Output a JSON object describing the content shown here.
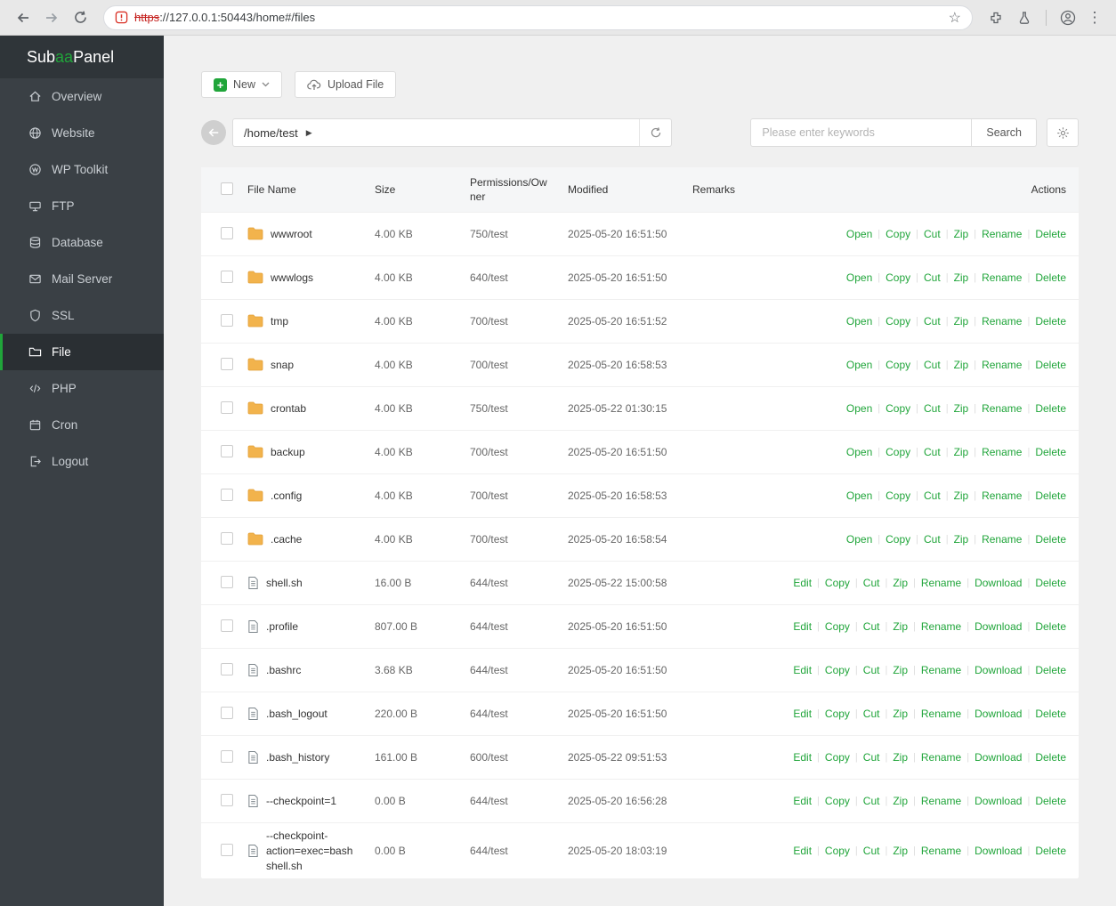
{
  "browser": {
    "url_scheme": "https",
    "url_rest": "://127.0.0.1:50443/home#/files"
  },
  "sidebar": {
    "logo": {
      "prefix": "Sub ",
      "accent": "aa",
      "suffix": "Panel"
    },
    "items": [
      {
        "label": "Overview",
        "icon": "home-icon",
        "active": false
      },
      {
        "label": "Website",
        "icon": "globe-icon",
        "active": false
      },
      {
        "label": "WP Toolkit",
        "icon": "wordpress-icon",
        "active": false
      },
      {
        "label": "FTP",
        "icon": "server-icon",
        "active": false
      },
      {
        "label": "Database",
        "icon": "database-icon",
        "active": false
      },
      {
        "label": "Mail Server",
        "icon": "mail-icon",
        "active": false
      },
      {
        "label": "SSL",
        "icon": "shield-icon",
        "active": false
      },
      {
        "label": "File",
        "icon": "folder-icon",
        "active": true
      },
      {
        "label": "PHP",
        "icon": "code-icon",
        "active": false
      },
      {
        "label": "Cron",
        "icon": "calendar-icon",
        "active": false
      },
      {
        "label": "Logout",
        "icon": "logout-icon",
        "active": false
      }
    ]
  },
  "toolbar": {
    "new_label": "New",
    "upload_label": "Upload File",
    "path": "/home/test",
    "search_placeholder": "Please enter keywords",
    "search_label": "Search"
  },
  "table": {
    "headers": [
      "File Name",
      "Size",
      "Permissions/Owner",
      "Modified",
      "Remarks",
      "Actions"
    ],
    "rows": [
      {
        "name": "wwwroot",
        "type": "folder",
        "size": "4.00 KB",
        "permissions": "750/test",
        "modified": "2025-05-20 16:51:50",
        "remarks": "",
        "actions": [
          "Open",
          "Copy",
          "Cut",
          "Zip",
          "Rename",
          "Delete"
        ]
      },
      {
        "name": "wwwlogs",
        "type": "folder",
        "size": "4.00 KB",
        "permissions": "640/test",
        "modified": "2025-05-20 16:51:50",
        "remarks": "",
        "actions": [
          "Open",
          "Copy",
          "Cut",
          "Zip",
          "Rename",
          "Delete"
        ]
      },
      {
        "name": "tmp",
        "type": "folder",
        "size": "4.00 KB",
        "permissions": "700/test",
        "modified": "2025-05-20 16:51:52",
        "remarks": "",
        "actions": [
          "Open",
          "Copy",
          "Cut",
          "Zip",
          "Rename",
          "Delete"
        ]
      },
      {
        "name": "snap",
        "type": "folder",
        "size": "4.00 KB",
        "permissions": "700/test",
        "modified": "2025-05-20 16:58:53",
        "remarks": "",
        "actions": [
          "Open",
          "Copy",
          "Cut",
          "Zip",
          "Rename",
          "Delete"
        ]
      },
      {
        "name": "crontab",
        "type": "folder",
        "size": "4.00 KB",
        "permissions": "750/test",
        "modified": "2025-05-22 01:30:15",
        "remarks": "",
        "actions": [
          "Open",
          "Copy",
          "Cut",
          "Zip",
          "Rename",
          "Delete"
        ]
      },
      {
        "name": "backup",
        "type": "folder",
        "size": "4.00 KB",
        "permissions": "700/test",
        "modified": "2025-05-20 16:51:50",
        "remarks": "",
        "actions": [
          "Open",
          "Copy",
          "Cut",
          "Zip",
          "Rename",
          "Delete"
        ]
      },
      {
        "name": ".config",
        "type": "folder",
        "size": "4.00 KB",
        "permissions": "700/test",
        "modified": "2025-05-20 16:58:53",
        "remarks": "",
        "actions": [
          "Open",
          "Copy",
          "Cut",
          "Zip",
          "Rename",
          "Delete"
        ]
      },
      {
        "name": ".cache",
        "type": "folder",
        "size": "4.00 KB",
        "permissions": "700/test",
        "modified": "2025-05-20 16:58:54",
        "remarks": "",
        "actions": [
          "Open",
          "Copy",
          "Cut",
          "Zip",
          "Rename",
          "Delete"
        ]
      },
      {
        "name": "shell.sh",
        "type": "file",
        "size": "16.00 B",
        "permissions": "644/test",
        "modified": "2025-05-22 15:00:58",
        "remarks": "",
        "actions": [
          "Edit",
          "Copy",
          "Cut",
          "Zip",
          "Rename",
          "Download",
          "Delete"
        ]
      },
      {
        "name": ".profile",
        "type": "file",
        "size": "807.00 B",
        "permissions": "644/test",
        "modified": "2025-05-20 16:51:50",
        "remarks": "",
        "actions": [
          "Edit",
          "Copy",
          "Cut",
          "Zip",
          "Rename",
          "Download",
          "Delete"
        ]
      },
      {
        "name": ".bashrc",
        "type": "file",
        "size": "3.68 KB",
        "permissions": "644/test",
        "modified": "2025-05-20 16:51:50",
        "remarks": "",
        "actions": [
          "Edit",
          "Copy",
          "Cut",
          "Zip",
          "Rename",
          "Download",
          "Delete"
        ]
      },
      {
        "name": ".bash_logout",
        "type": "file",
        "size": "220.00 B",
        "permissions": "644/test",
        "modified": "2025-05-20 16:51:50",
        "remarks": "",
        "actions": [
          "Edit",
          "Copy",
          "Cut",
          "Zip",
          "Rename",
          "Download",
          "Delete"
        ]
      },
      {
        "name": ".bash_history",
        "type": "file",
        "size": "161.00 B",
        "permissions": "600/test",
        "modified": "2025-05-22 09:51:53",
        "remarks": "",
        "actions": [
          "Edit",
          "Copy",
          "Cut",
          "Zip",
          "Rename",
          "Download",
          "Delete"
        ]
      },
      {
        "name": "--checkpoint=1",
        "type": "file",
        "size": "0.00 B",
        "permissions": "644/test",
        "modified": "2025-05-20 16:56:28",
        "remarks": "",
        "actions": [
          "Edit",
          "Copy",
          "Cut",
          "Zip",
          "Rename",
          "Download",
          "Delete"
        ]
      },
      {
        "name": "--checkpoint-action=exec=bash shell.sh",
        "type": "file",
        "size": "0.00 B",
        "permissions": "644/test",
        "modified": "2025-05-20 18:03:19",
        "remarks": "",
        "actions": [
          "Edit",
          "Copy",
          "Cut",
          "Zip",
          "Rename",
          "Download",
          "Delete"
        ]
      }
    ]
  },
  "colors": {
    "accent_green": "#20a53a",
    "folder_yellow": "#f2b34c",
    "sidebar_bg": "#3a4045",
    "insecure_red": "#c5221f"
  }
}
